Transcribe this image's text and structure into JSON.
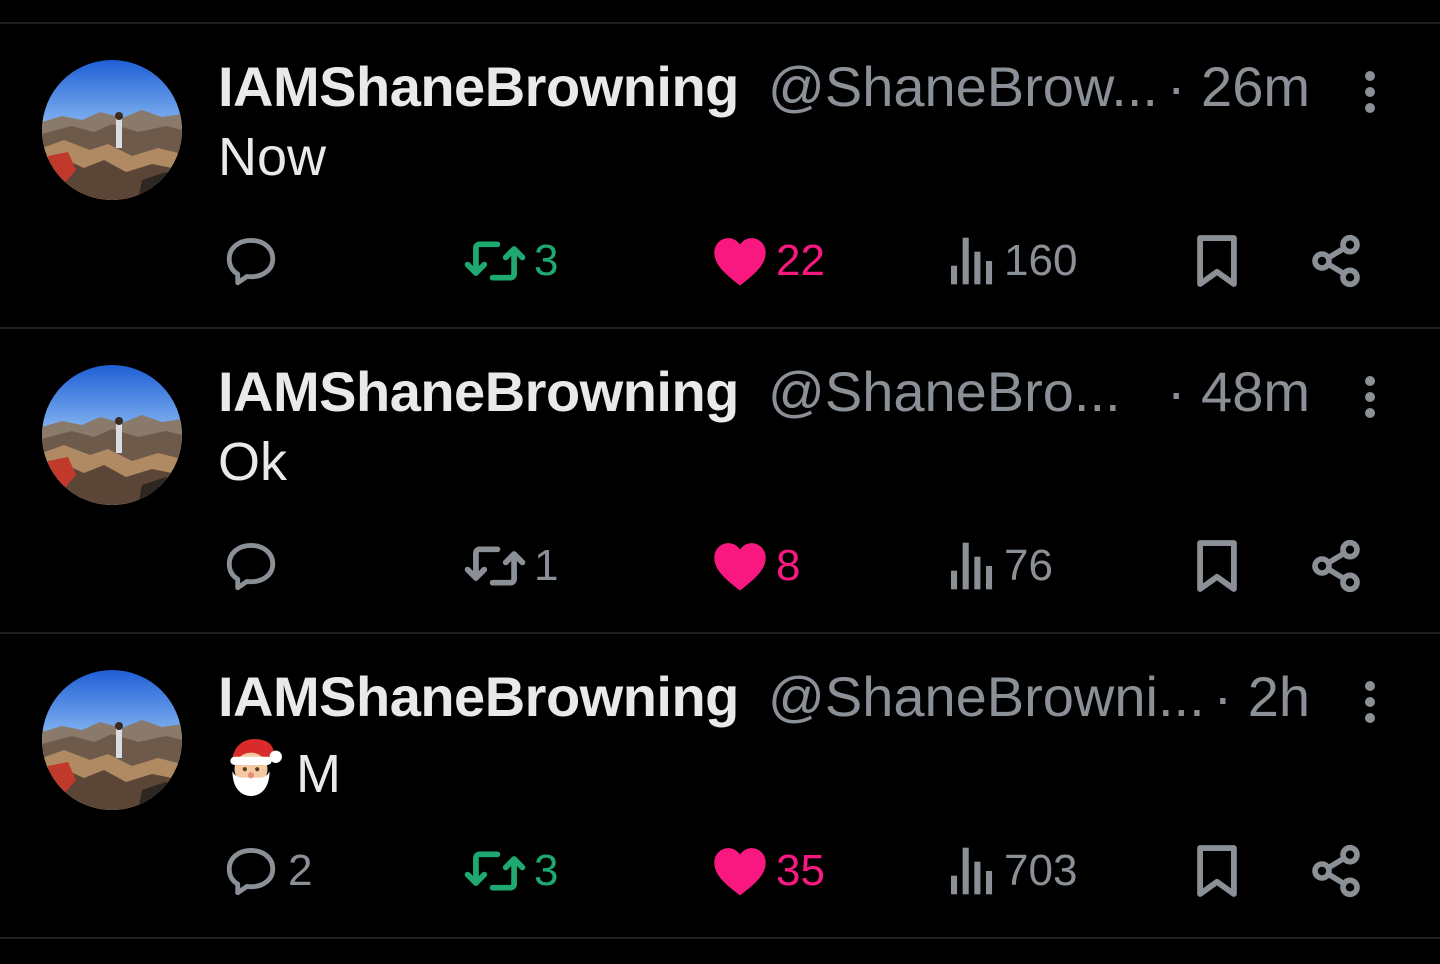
{
  "colors": {
    "background": "#000000",
    "text": "#e7e9ea",
    "muted": "#8b9097",
    "retweet_active": "#1ea971",
    "like_active": "#f91880",
    "divider": "#1c1f23"
  },
  "tweets": [
    {
      "display_name": "IAMShaneBrowning",
      "handle": "@ShaneBrow...",
      "time": "· 26m",
      "text": "Now",
      "emoji": "",
      "replies": "",
      "retweets": "3",
      "retweeted": true,
      "likes": "22",
      "liked": true,
      "views": "160"
    },
    {
      "display_name": "IAMShaneBrowning",
      "handle": "@ShaneBro...",
      "time": "· 48m",
      "text": "Ok",
      "emoji": "",
      "replies": "",
      "retweets": "1",
      "retweeted": false,
      "likes": "8",
      "liked": true,
      "views": "76"
    },
    {
      "display_name": "IAMShaneBrowning",
      "handle": "@ShaneBrowni...",
      "time": "· 2h",
      "text": "M",
      "emoji": "santa-emoji",
      "replies": "2",
      "retweets": "3",
      "retweeted": true,
      "likes": "35",
      "liked": true,
      "views": "703"
    }
  ],
  "icons": {
    "reply": "reply-icon",
    "retweet": "retweet-icon",
    "like": "heart-icon",
    "views": "views-icon",
    "bookmark": "bookmark-icon",
    "share": "share-icon",
    "more": "more-vertical-icon"
  }
}
